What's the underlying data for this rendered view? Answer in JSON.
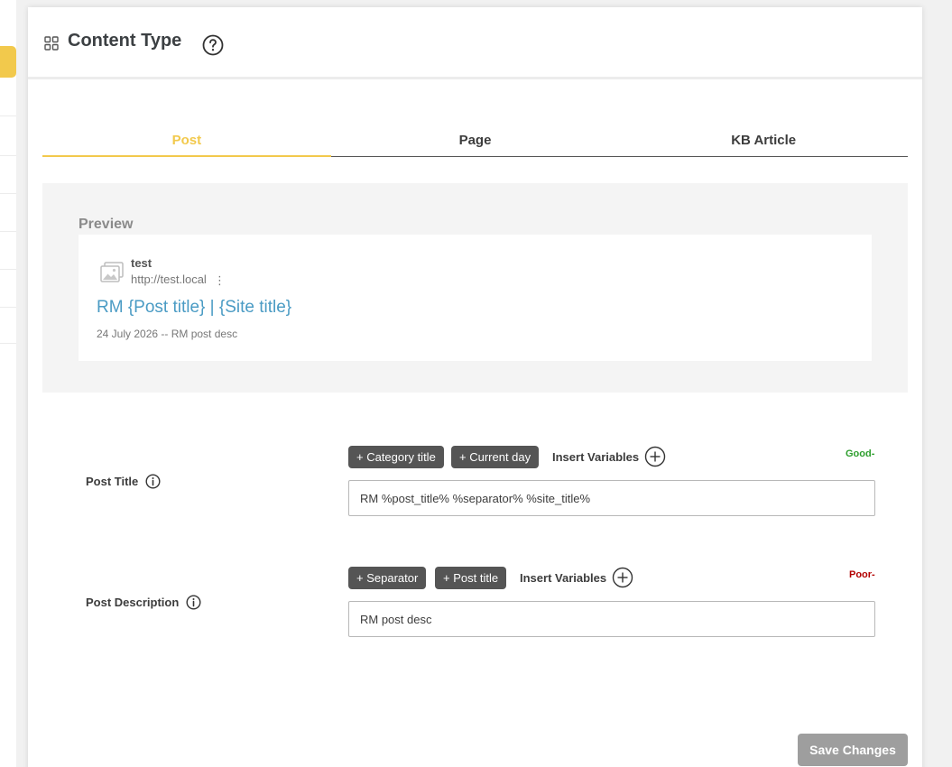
{
  "header": {
    "title": "Content Type"
  },
  "tabs": [
    {
      "label": "Post",
      "active": true
    },
    {
      "label": "Page",
      "active": false
    },
    {
      "label": "KB Article",
      "active": false
    }
  ],
  "preview": {
    "label": "Preview",
    "site_name": "test",
    "site_url": "http://test.local",
    "url_menu": "⋮",
    "title": "RM {Post title} | {Site title}",
    "meta": "24 July 2026 -- RM post desc"
  },
  "post_title": {
    "label": "Post Title",
    "chips": [
      "+ Category title",
      "+ Current day"
    ],
    "insert_variables": "Insert Variables",
    "score": "Good-",
    "value": "RM %post_title% %separator% %site_title%"
  },
  "post_description": {
    "label": "Post Description",
    "chips": [
      "+ Separator",
      "+ Post title"
    ],
    "insert_variables": "Insert Variables",
    "score": "Poor-",
    "value": "RM post desc"
  },
  "colors": {
    "accent": "#f2c94c",
    "link": "#4a9bc4",
    "good": "#2e9e2e",
    "poor": "#b30000"
  },
  "footer": {
    "save_label": "Save Changes"
  }
}
